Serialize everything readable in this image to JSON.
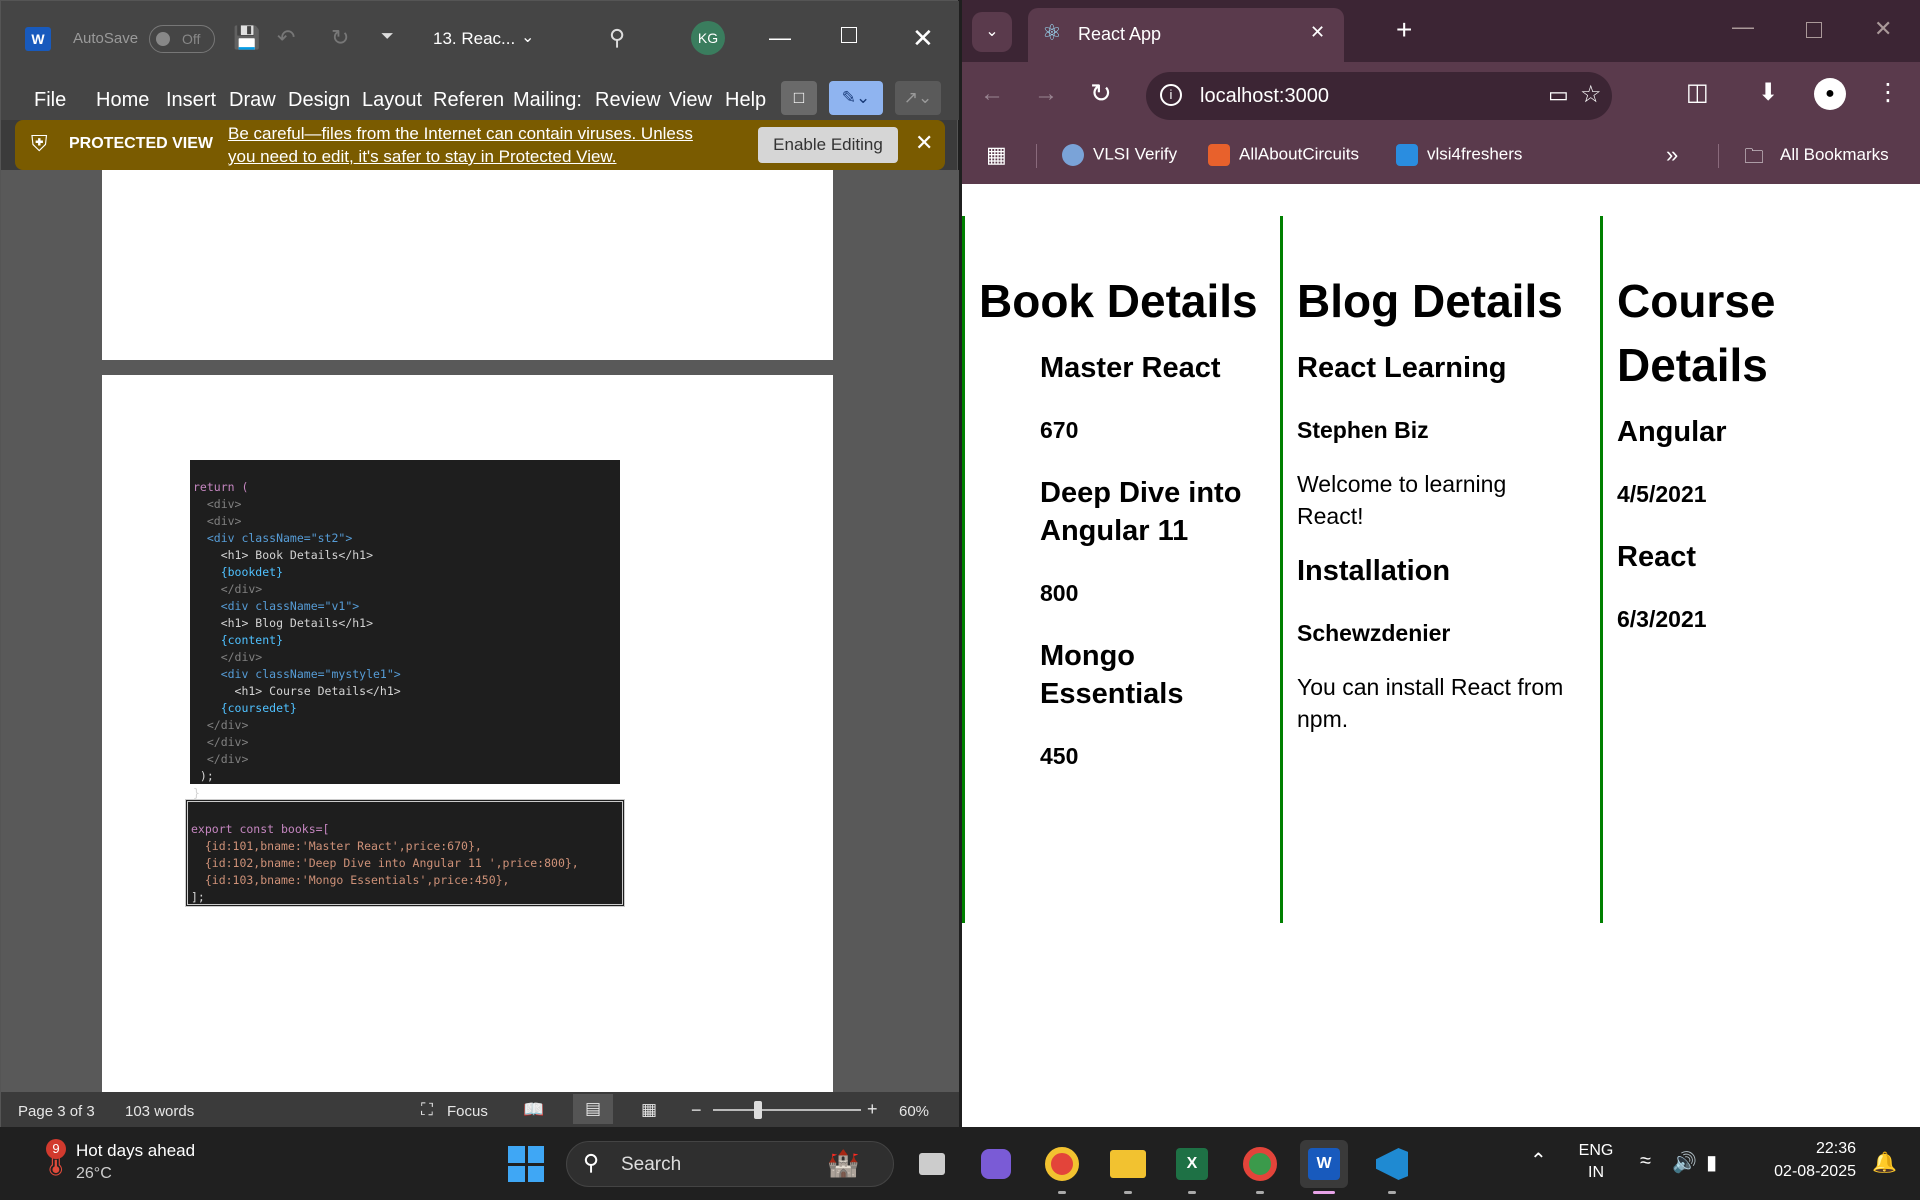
{
  "word": {
    "title": {
      "autosave_label": "AutoSave",
      "autosave_state": "Off",
      "doc_name": "13. Reac...",
      "user_initials": "KG"
    },
    "menu": [
      "File",
      "Home",
      "Insert",
      "Draw",
      "Design",
      "Layout",
      "Referenc",
      "Mailing:",
      "Review",
      "View",
      "Help"
    ],
    "protected": {
      "label": "PROTECTED VIEW",
      "message_line1": "Be careful—files from the Internet can contain viruses. Unless",
      "message_line2": "you need to edit, it's safer to stay in Protected View.",
      "button": "Enable Editing"
    },
    "code1": [
      "return (",
      "  <div>",
      "  <div>",
      "  <div className=\"st2\">",
      "    <h1> Book Details</h1>",
      "    {bookdet}",
      "    </div>",
      "    <div className=\"v1\">",
      "    <h1> Blog Details</h1>",
      "    {content}",
      "    </div>",
      "    <div className=\"mystyle1\">",
      "      <h1> Course Details</h1>",
      "    {coursedet}",
      "  </div>",
      "  </div>",
      "  </div>",
      " );",
      "}"
    ],
    "code2": [
      "export const books=[",
      "  {id:101,bname:'Master React',price:670},",
      "  {id:102,bname:'Deep Dive into Angular 11 ',price:800},",
      "  {id:103,bname:'Mongo Essentials',price:450},",
      "];"
    ],
    "status": {
      "page": "Page 3 of 3",
      "words": "103 words",
      "focus": "Focus",
      "zoom": "60%"
    }
  },
  "browser": {
    "tab_title": "React App",
    "url": "localhost:3000",
    "bookmarks": [
      "VLSI Verify",
      "AllAboutCircuits",
      "vlsi4freshers"
    ],
    "all_bookmarks": "All Bookmarks",
    "page": {
      "book": {
        "heading": "Book Details",
        "items": [
          {
            "name": "Master React",
            "price": "670"
          },
          {
            "name": "Deep Dive into Angular 11",
            "price": "800"
          },
          {
            "name": "Mongo Essentials",
            "price": "450"
          }
        ]
      },
      "blog": {
        "heading": "Blog Details",
        "posts": [
          {
            "title": "React Learning",
            "author": "Stephen Biz",
            "body": "Welcome to learning React!"
          },
          {
            "title": "Installation",
            "author": "Schewzdenier",
            "body": "You can install React from npm."
          }
        ]
      },
      "course": {
        "heading": "Course Details",
        "items": [
          {
            "name": "Angular",
            "date": "4/5/2021"
          },
          {
            "name": "React",
            "date": "6/3/2021"
          }
        ]
      }
    }
  },
  "taskbar": {
    "weather_title": "Hot days ahead",
    "weather_temp": "26°C",
    "weather_badge": "9",
    "search": "Search",
    "lang1": "ENG",
    "lang2": "IN",
    "time": "22:36",
    "date": "02-08-2025"
  },
  "colors": {
    "word_protected_bar": "#7a5b00",
    "browser_frame": "#5a3a4c",
    "column_border": "#008000"
  }
}
